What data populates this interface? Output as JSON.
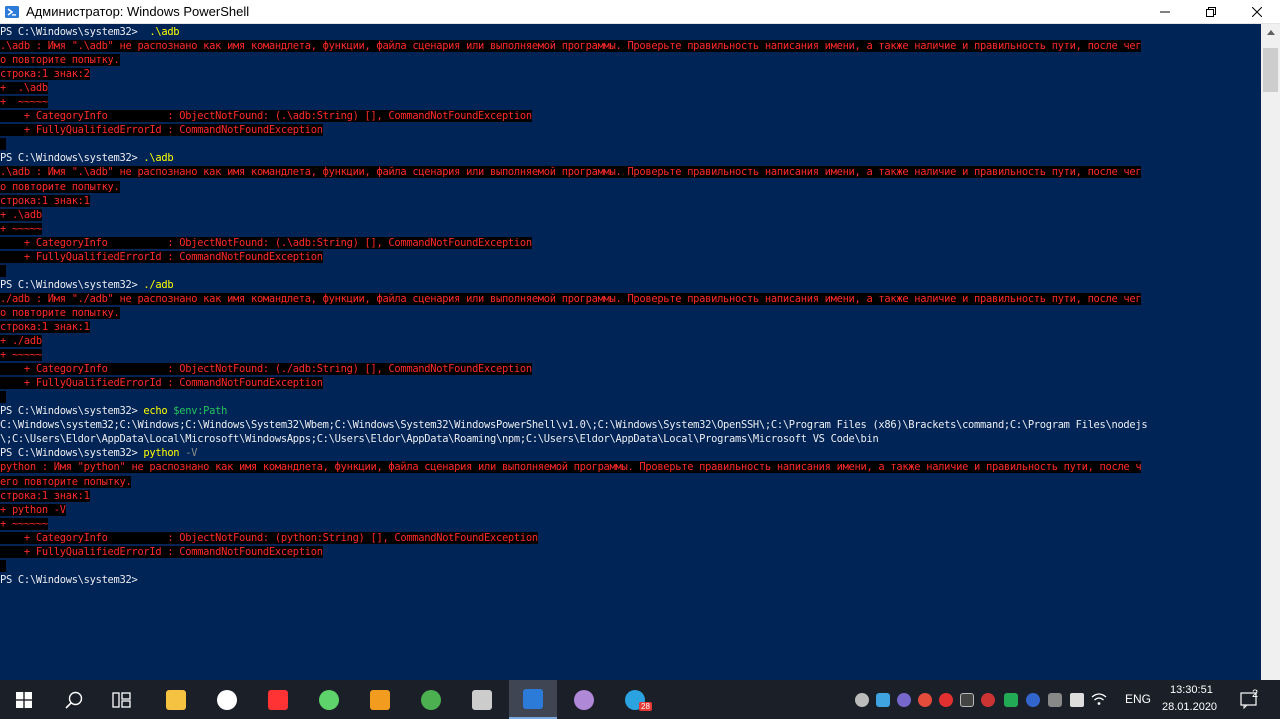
{
  "window": {
    "title": "Администратор: Windows PowerShell",
    "minimize_icon": "minimize-icon",
    "maximize_icon": "restore-icon",
    "close_icon": "close-icon"
  },
  "colors": {
    "background": "#012456",
    "text": "#eeedf0",
    "error_text": "#ff2a2a",
    "error_bg": "#000000",
    "command": "#ffff00",
    "variable": "#22c55e",
    "parameter": "#8c8c8c"
  },
  "console": {
    "lines": [
      {
        "type": "cmd",
        "prompt": "PS C:\\Windows\\system32> ",
        "cmd": " .\\adb",
        "arg": "",
        "rest": ""
      },
      {
        "type": "err",
        "text": ".\\adb : Имя \".\\adb\" не распознано как имя командлета, функции, файла сценария или выполняемой программы. Проверьте правильность написания имени, а также наличие и правильность пути, после чег"
      },
      {
        "type": "err",
        "text": "о повторите попытку."
      },
      {
        "type": "err",
        "text": "строка:1 знак:2"
      },
      {
        "type": "err",
        "text": "+  .\\adb"
      },
      {
        "type": "err",
        "text": "+  ~~~~~"
      },
      {
        "type": "err",
        "text": "    + CategoryInfo          : ObjectNotFound: (.\\adb:String) [], CommandNotFoundException"
      },
      {
        "type": "err",
        "text": "    + FullyQualifiedErrorId : CommandNotFoundException"
      },
      {
        "type": "err",
        "text": " "
      },
      {
        "type": "cmd",
        "prompt": "PS C:\\Windows\\system32> ",
        "cmd": ".\\adb",
        "arg": "",
        "rest": ""
      },
      {
        "type": "err",
        "text": ".\\adb : Имя \".\\adb\" не распознано как имя командлета, функции, файла сценария или выполняемой программы. Проверьте правильность написания имени, а также наличие и правильность пути, после чег"
      },
      {
        "type": "err",
        "text": "о повторите попытку."
      },
      {
        "type": "err",
        "text": "строка:1 знак:1"
      },
      {
        "type": "err",
        "text": "+ .\\adb"
      },
      {
        "type": "err",
        "text": "+ ~~~~~"
      },
      {
        "type": "err",
        "text": "    + CategoryInfo          : ObjectNotFound: (.\\adb:String) [], CommandNotFoundException"
      },
      {
        "type": "err",
        "text": "    + FullyQualifiedErrorId : CommandNotFoundException"
      },
      {
        "type": "err",
        "text": " "
      },
      {
        "type": "cmd",
        "prompt": "PS C:\\Windows\\system32> ",
        "cmd": "./adb",
        "arg": "",
        "rest": ""
      },
      {
        "type": "err",
        "text": "./adb : Имя \"./adb\" не распознано как имя командлета, функции, файла сценария или выполняемой программы. Проверьте правильность написания имени, а также наличие и правильность пути, после чег"
      },
      {
        "type": "err",
        "text": "о повторите попытку."
      },
      {
        "type": "err",
        "text": "строка:1 знак:1"
      },
      {
        "type": "err",
        "text": "+ ./adb"
      },
      {
        "type": "err",
        "text": "+ ~~~~~"
      },
      {
        "type": "err",
        "text": "    + CategoryInfo          : ObjectNotFound: (./adb:String) [], CommandNotFoundException"
      },
      {
        "type": "err",
        "text": "    + FullyQualifiedErrorId : CommandNotFoundException"
      },
      {
        "type": "err",
        "text": " "
      },
      {
        "type": "cmd",
        "prompt": "PS C:\\Windows\\system32> ",
        "cmd": "echo",
        "var": " $env:Path",
        "arg": "",
        "rest": ""
      },
      {
        "type": "out",
        "text": "C:\\Windows\\system32;C:\\Windows;C:\\Windows\\System32\\Wbem;C:\\Windows\\System32\\WindowsPowerShell\\v1.0\\;C:\\Windows\\System32\\OpenSSH\\;C:\\Program Files (x86)\\Brackets\\command;C:\\Program Files\\nodejs"
      },
      {
        "type": "out",
        "text": "\\;C:\\Users\\Eldor\\AppData\\Local\\Microsoft\\WindowsApps;C:\\Users\\Eldor\\AppData\\Roaming\\npm;C:\\Users\\Eldor\\AppData\\Local\\Programs\\Microsoft VS Code\\bin"
      },
      {
        "type": "cmd",
        "prompt": "PS C:\\Windows\\system32> ",
        "cmd": "python",
        "arg": " -V",
        "rest": ""
      },
      {
        "type": "err",
        "text": "python : Имя \"python\" не распознано как имя командлета, функции, файла сценария или выполняемой программы. Проверьте правильность написания имени, а также наличие и правильность пути, после ч"
      },
      {
        "type": "err",
        "text": "его повторите попытку."
      },
      {
        "type": "err",
        "text": "строка:1 знак:1"
      },
      {
        "type": "err",
        "text": "+ python -V"
      },
      {
        "type": "err",
        "text": "+ ~~~~~~"
      },
      {
        "type": "err",
        "text": "    + CategoryInfo          : ObjectNotFound: (python:String) [], CommandNotFoundException"
      },
      {
        "type": "err",
        "text": "    + FullyQualifiedErrorId : CommandNotFoundException"
      },
      {
        "type": "err",
        "text": " "
      },
      {
        "type": "cmd",
        "prompt": "PS C:\\Windows\\system32> ",
        "cmd": "",
        "arg": "",
        "rest": ""
      }
    ]
  },
  "taskbar": {
    "start_icon": "windows-start-icon",
    "search_icon": "search-icon",
    "taskview_icon": "task-view-icon",
    "apps": [
      {
        "name": "file-explorer-icon",
        "color": "#f5c242"
      },
      {
        "name": "microsoft-store-icon",
        "color": "#ffffff"
      },
      {
        "name": "yandex-browser-icon",
        "color": "#ff3333"
      },
      {
        "name": "atom-editor-icon",
        "color": "#5fd36b"
      },
      {
        "name": "sublime-text-icon",
        "color": "#f29c1f"
      },
      {
        "name": "chrome-icon",
        "color": "#4caf50"
      },
      {
        "name": "command-prompt-icon",
        "color": "#cccccc"
      },
      {
        "name": "powershell-icon",
        "color": "#2c7bd8"
      },
      {
        "name": "tor-browser-icon",
        "color": "#b088d8"
      },
      {
        "name": "telegram-icon",
        "color": "#2aa3e0"
      }
    ],
    "telegram_badge": "28",
    "language": "ENG",
    "time": "13:30:51",
    "date": "28.01.2020",
    "notifications_count": "2"
  }
}
